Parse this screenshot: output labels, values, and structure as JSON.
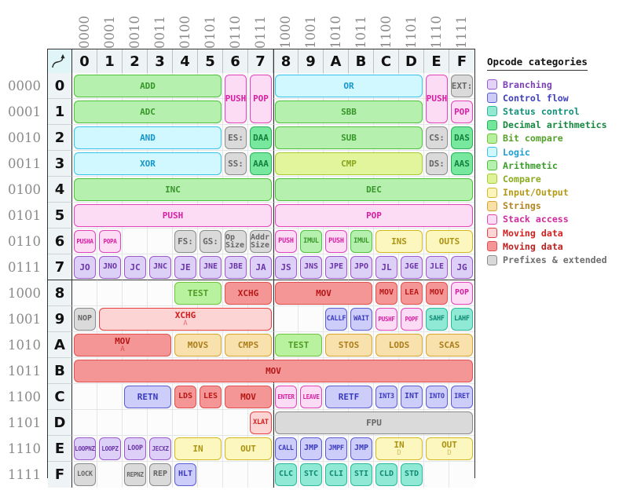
{
  "table": {
    "corner_icon": "arrow-up-right-icon",
    "col_headers": [
      "0",
      "1",
      "2",
      "3",
      "4",
      "5",
      "6",
      "7",
      "8",
      "9",
      "A",
      "B",
      "C",
      "D",
      "E",
      "F"
    ],
    "col_binary": [
      "0000",
      "0001",
      "0010",
      "0011",
      "0100",
      "0101",
      "0110",
      "0111",
      "1000",
      "1001",
      "1010",
      "1011",
      "1100",
      "1101",
      "1110",
      "1111"
    ],
    "row_headers": [
      "0",
      "1",
      "2",
      "3",
      "4",
      "5",
      "6",
      "7",
      "8",
      "9",
      "A",
      "B",
      "C",
      "D",
      "E",
      "F"
    ],
    "row_binary": [
      "0000",
      "0001",
      "0010",
      "0011",
      "0100",
      "0101",
      "0110",
      "0111",
      "1000",
      "1001",
      "1010",
      "1011",
      "1100",
      "1101",
      "1110",
      "1111"
    ]
  },
  "legend": {
    "title": "Opcode categories",
    "items": [
      {
        "label": "Branching",
        "fill": "#e3d3f7",
        "stroke": "#9b59d0",
        "text": "#7b3fb8"
      },
      {
        "label": "Control flow",
        "fill": "#ccccf7",
        "stroke": "#5b5bd6",
        "text": "#4040c0"
      },
      {
        "label": "Status control",
        "fill": "#92e8d0",
        "stroke": "#2cb89a",
        "text": "#11907a"
      },
      {
        "label": "Decimal arithmetics",
        "fill": "#72e69a",
        "stroke": "#27b258",
        "text": "#17883f"
      },
      {
        "label": "Bit compare",
        "fill": "#b6f09c",
        "stroke": "#6fc23a",
        "text": "#55a02a"
      },
      {
        "label": "Logic",
        "fill": "#d0f7ff",
        "stroke": "#35c2ee",
        "text": "#1e9fd0"
      },
      {
        "label": "Arithmetic",
        "fill": "#b6f0ae",
        "stroke": "#4ec23a",
        "text": "#3a9e2a"
      },
      {
        "label": "Compare",
        "fill": "#dff29a",
        "stroke": "#a7cc2f",
        "text": "#8aab20"
      },
      {
        "label": "Input/Output",
        "fill": "#fbf5bd",
        "stroke": "#d4b820",
        "text": "#b39a16"
      },
      {
        "label": "Strings",
        "fill": "#f7dfa8",
        "stroke": "#d9a42e",
        "text": "#b38420"
      },
      {
        "label": "Stack access",
        "fill": "#fcddf4",
        "stroke": "#e243b8",
        "text": "#d12aa0"
      },
      {
        "label": "Moving data",
        "fill": "#fcd6d6",
        "stroke": "#e84040",
        "text": "#d52020"
      },
      {
        "label": "Moving data",
        "fill": "#f59696",
        "stroke": "#e05050",
        "text": "#c02020"
      },
      {
        "label": "Prefixes & extended",
        "fill": "#d8d8d8",
        "stroke": "#8a8a8a",
        "text": "#6e6e6e"
      }
    ]
  },
  "palette": {
    "branching": {
      "fill": "#ddd0f7",
      "stroke": "#9b59d0",
      "text": "#6a34a8"
    },
    "control": {
      "fill": "#cdcdf9",
      "stroke": "#5b5bd6",
      "text": "#3a3ac0"
    },
    "status": {
      "fill": "#8fe9d4",
      "stroke": "#2cb89a",
      "text": "#0e8a74"
    },
    "decimal": {
      "fill": "#78e89e",
      "stroke": "#27b258",
      "text": "#15803c"
    },
    "bitcompare": {
      "fill": "#b8f29e",
      "stroke": "#6fc23a",
      "text": "#4f9c25"
    },
    "logic": {
      "fill": "#d2f8ff",
      "stroke": "#35c2ee",
      "text": "#1595cb"
    },
    "arithmetic": {
      "fill": "#b6f0ae",
      "stroke": "#4ec23a",
      "text": "#37962a"
    },
    "compare": {
      "fill": "#e2f49c",
      "stroke": "#a7cc2f",
      "text": "#86a61c"
    },
    "io": {
      "fill": "#fcf7bf",
      "stroke": "#d4b820",
      "text": "#ad9312"
    },
    "strings": {
      "fill": "#f8e1ac",
      "stroke": "#d9a42e",
      "text": "#ad7e1c"
    },
    "stack": {
      "fill": "#fcdcf4",
      "stroke": "#e243b8",
      "text": "#d81fa2"
    },
    "moving": {
      "fill": "#fcd4d4",
      "stroke": "#e84040",
      "text": "#d41c1c"
    },
    "moving2": {
      "fill": "#f59696",
      "stroke": "#e05050",
      "text": "#b81818"
    },
    "prefix": {
      "fill": "#dadada",
      "stroke": "#8a8a8a",
      "text": "#666666"
    }
  },
  "cells": [
    {
      "row": 0,
      "col": 0,
      "span": 6,
      "rows": 1,
      "label": "ADD",
      "cat": "arithmetic"
    },
    {
      "row": 0,
      "col": 6,
      "span": 1,
      "rows": 2,
      "label": "PUSH",
      "cat": "stack"
    },
    {
      "row": 0,
      "col": 7,
      "span": 1,
      "rows": 2,
      "label": "POP",
      "cat": "stack"
    },
    {
      "row": 0,
      "col": 8,
      "span": 6,
      "rows": 1,
      "label": "OR",
      "cat": "logic"
    },
    {
      "row": 0,
      "col": 14,
      "span": 1,
      "rows": 2,
      "label": "PUSH",
      "cat": "stack"
    },
    {
      "row": 0,
      "col": 15,
      "span": 1,
      "rows": 1,
      "label": "EXT:",
      "cat": "prefix"
    },
    {
      "row": 1,
      "col": 0,
      "span": 6,
      "rows": 1,
      "label": "ADC",
      "cat": "arithmetic"
    },
    {
      "row": 1,
      "col": 8,
      "span": 6,
      "rows": 1,
      "label": "SBB",
      "cat": "arithmetic"
    },
    {
      "row": 1,
      "col": 15,
      "span": 1,
      "rows": 1,
      "label": "POP",
      "cat": "stack"
    },
    {
      "row": 2,
      "col": 0,
      "span": 6,
      "rows": 1,
      "label": "AND",
      "cat": "logic"
    },
    {
      "row": 2,
      "col": 6,
      "span": 1,
      "rows": 1,
      "label": "ES:",
      "cat": "prefix"
    },
    {
      "row": 2,
      "col": 7,
      "span": 1,
      "rows": 1,
      "label": "DAA",
      "cat": "decimal"
    },
    {
      "row": 2,
      "col": 8,
      "span": 6,
      "rows": 1,
      "label": "SUB",
      "cat": "arithmetic"
    },
    {
      "row": 2,
      "col": 14,
      "span": 1,
      "rows": 1,
      "label": "CS:",
      "cat": "prefix"
    },
    {
      "row": 2,
      "col": 15,
      "span": 1,
      "rows": 1,
      "label": "DAS",
      "cat": "decimal"
    },
    {
      "row": 3,
      "col": 0,
      "span": 6,
      "rows": 1,
      "label": "XOR",
      "cat": "logic"
    },
    {
      "row": 3,
      "col": 6,
      "span": 1,
      "rows": 1,
      "label": "SS:",
      "cat": "prefix"
    },
    {
      "row": 3,
      "col": 7,
      "span": 1,
      "rows": 1,
      "label": "AAA",
      "cat": "decimal"
    },
    {
      "row": 3,
      "col": 8,
      "span": 6,
      "rows": 1,
      "label": "CMP",
      "cat": "compare"
    },
    {
      "row": 3,
      "col": 14,
      "span": 1,
      "rows": 1,
      "label": "DS:",
      "cat": "prefix"
    },
    {
      "row": 3,
      "col": 15,
      "span": 1,
      "rows": 1,
      "label": "AAS",
      "cat": "decimal"
    },
    {
      "row": 4,
      "col": 0,
      "span": 8,
      "rows": 1,
      "label": "INC",
      "cat": "arithmetic"
    },
    {
      "row": 4,
      "col": 8,
      "span": 8,
      "rows": 1,
      "label": "DEC",
      "cat": "arithmetic"
    },
    {
      "row": 5,
      "col": 0,
      "span": 8,
      "rows": 1,
      "label": "PUSH",
      "cat": "stack"
    },
    {
      "row": 5,
      "col": 8,
      "span": 8,
      "rows": 1,
      "label": "POP",
      "cat": "stack"
    },
    {
      "row": 6,
      "col": 0,
      "span": 1,
      "rows": 1,
      "label": "PUSHA",
      "cat": "stack",
      "size": "f8"
    },
    {
      "row": 6,
      "col": 1,
      "span": 1,
      "rows": 1,
      "label": "POPA",
      "cat": "stack",
      "size": "f8"
    },
    {
      "row": 6,
      "col": 4,
      "span": 1,
      "rows": 1,
      "label": "FS:",
      "cat": "prefix"
    },
    {
      "row": 6,
      "col": 5,
      "span": 1,
      "rows": 1,
      "label": "GS:",
      "cat": "prefix"
    },
    {
      "row": 6,
      "col": 6,
      "span": 1,
      "rows": 1,
      "label": "Op Size",
      "cat": "prefix",
      "wrap": true
    },
    {
      "row": 6,
      "col": 7,
      "span": 1,
      "rows": 1,
      "label": "Addr Size",
      "cat": "prefix",
      "wrap": true
    },
    {
      "row": 6,
      "col": 8,
      "span": 1,
      "rows": 1,
      "label": "PUSH",
      "cat": "stack",
      "size": "f9"
    },
    {
      "row": 6,
      "col": 9,
      "span": 1,
      "rows": 1,
      "label": "IMUL",
      "cat": "arithmetic",
      "size": "f9"
    },
    {
      "row": 6,
      "col": 10,
      "span": 1,
      "rows": 1,
      "label": "PUSH",
      "cat": "stack",
      "size": "f9"
    },
    {
      "row": 6,
      "col": 11,
      "span": 1,
      "rows": 1,
      "label": "IMUL",
      "cat": "arithmetic",
      "size": "f9"
    },
    {
      "row": 6,
      "col": 12,
      "span": 2,
      "rows": 1,
      "label": "INS",
      "cat": "io"
    },
    {
      "row": 6,
      "col": 14,
      "span": 2,
      "rows": 1,
      "label": "OUTS",
      "cat": "io"
    },
    {
      "row": 7,
      "col": 0,
      "span": 1,
      "rows": 1,
      "label": "JO",
      "cat": "branching"
    },
    {
      "row": 7,
      "col": 1,
      "span": 1,
      "rows": 1,
      "label": "JNO",
      "cat": "branching",
      "size": "f10"
    },
    {
      "row": 7,
      "col": 2,
      "span": 1,
      "rows": 1,
      "label": "JC",
      "cat": "branching"
    },
    {
      "row": 7,
      "col": 3,
      "span": 1,
      "rows": 1,
      "label": "JNC",
      "cat": "branching",
      "size": "f10"
    },
    {
      "row": 7,
      "col": 4,
      "span": 1,
      "rows": 1,
      "label": "JE",
      "cat": "branching"
    },
    {
      "row": 7,
      "col": 5,
      "span": 1,
      "rows": 1,
      "label": "JNE",
      "cat": "branching",
      "size": "f10"
    },
    {
      "row": 7,
      "col": 6,
      "span": 1,
      "rows": 1,
      "label": "JBE",
      "cat": "branching",
      "size": "f10"
    },
    {
      "row": 7,
      "col": 7,
      "span": 1,
      "rows": 1,
      "label": "JA",
      "cat": "branching"
    },
    {
      "row": 7,
      "col": 8,
      "span": 1,
      "rows": 1,
      "label": "JS",
      "cat": "branching"
    },
    {
      "row": 7,
      "col": 9,
      "span": 1,
      "rows": 1,
      "label": "JNS",
      "cat": "branching",
      "size": "f10"
    },
    {
      "row": 7,
      "col": 10,
      "span": 1,
      "rows": 1,
      "label": "JPE",
      "cat": "branching",
      "size": "f10"
    },
    {
      "row": 7,
      "col": 11,
      "span": 1,
      "rows": 1,
      "label": "JPO",
      "cat": "branching",
      "size": "f10"
    },
    {
      "row": 7,
      "col": 12,
      "span": 1,
      "rows": 1,
      "label": "JL",
      "cat": "branching"
    },
    {
      "row": 7,
      "col": 13,
      "span": 1,
      "rows": 1,
      "label": "JGE",
      "cat": "branching",
      "size": "f10"
    },
    {
      "row": 7,
      "col": 14,
      "span": 1,
      "rows": 1,
      "label": "JLE",
      "cat": "branching",
      "size": "f10"
    },
    {
      "row": 7,
      "col": 15,
      "span": 1,
      "rows": 1,
      "label": "JG",
      "cat": "branching"
    },
    {
      "row": 8,
      "col": 4,
      "span": 2,
      "rows": 1,
      "label": "TEST",
      "cat": "bitcompare"
    },
    {
      "row": 8,
      "col": 6,
      "span": 2,
      "rows": 1,
      "label": "XCHG",
      "cat": "moving2"
    },
    {
      "row": 8,
      "col": 8,
      "span": 4,
      "rows": 1,
      "label": "MOV",
      "cat": "moving2"
    },
    {
      "row": 8,
      "col": 12,
      "span": 1,
      "rows": 1,
      "label": "MOV",
      "cat": "moving2",
      "size": "f10"
    },
    {
      "row": 8,
      "col": 13,
      "span": 1,
      "rows": 1,
      "label": "LEA",
      "cat": "moving2",
      "size": "f10"
    },
    {
      "row": 8,
      "col": 14,
      "span": 1,
      "rows": 1,
      "label": "MOV",
      "cat": "moving2",
      "size": "f10"
    },
    {
      "row": 8,
      "col": 15,
      "span": 1,
      "rows": 1,
      "label": "POP",
      "cat": "stack",
      "size": "f10"
    },
    {
      "row": 9,
      "col": 0,
      "span": 1,
      "rows": 1,
      "label": "NOP",
      "cat": "prefix",
      "size": "f10"
    },
    {
      "row": 9,
      "col": 1,
      "span": 7,
      "rows": 1,
      "label": "XCHG",
      "sub": "A",
      "cat": "moving"
    },
    {
      "row": 9,
      "col": 10,
      "span": 1,
      "rows": 1,
      "label": "CALLF",
      "cat": "control",
      "size": "f9"
    },
    {
      "row": 9,
      "col": 11,
      "span": 1,
      "rows": 1,
      "label": "WAIT",
      "cat": "control",
      "size": "f9"
    },
    {
      "row": 9,
      "col": 12,
      "span": 1,
      "rows": 1,
      "label": "PUSHF",
      "cat": "stack",
      "size": "f8"
    },
    {
      "row": 9,
      "col": 13,
      "span": 1,
      "rows": 1,
      "label": "POPF",
      "cat": "stack",
      "size": "f8"
    },
    {
      "row": 9,
      "col": 14,
      "span": 1,
      "rows": 1,
      "label": "SAHF",
      "cat": "status",
      "size": "f9"
    },
    {
      "row": 9,
      "col": 15,
      "span": 1,
      "rows": 1,
      "label": "LAHF",
      "cat": "status",
      "size": "f9"
    },
    {
      "row": 10,
      "col": 0,
      "span": 4,
      "rows": 1,
      "label": "MOV",
      "sub": "A",
      "cat": "moving2"
    },
    {
      "row": 10,
      "col": 4,
      "span": 2,
      "rows": 1,
      "label": "MOVS",
      "cat": "strings"
    },
    {
      "row": 10,
      "col": 6,
      "span": 2,
      "rows": 1,
      "label": "CMPS",
      "cat": "strings"
    },
    {
      "row": 10,
      "col": 8,
      "span": 2,
      "rows": 1,
      "label": "TEST",
      "cat": "bitcompare"
    },
    {
      "row": 10,
      "col": 10,
      "span": 2,
      "rows": 1,
      "label": "STOS",
      "cat": "strings"
    },
    {
      "row": 10,
      "col": 12,
      "span": 2,
      "rows": 1,
      "label": "LODS",
      "cat": "strings"
    },
    {
      "row": 10,
      "col": 14,
      "span": 2,
      "rows": 1,
      "label": "SCAS",
      "cat": "strings"
    },
    {
      "row": 11,
      "col": 0,
      "span": 16,
      "rows": 1,
      "label": "MOV",
      "cat": "moving2"
    },
    {
      "row": 12,
      "col": 2,
      "span": 2,
      "rows": 1,
      "label": "RETN",
      "cat": "control"
    },
    {
      "row": 12,
      "col": 4,
      "span": 1,
      "rows": 1,
      "label": "LDS",
      "cat": "moving2",
      "size": "f10"
    },
    {
      "row": 12,
      "col": 5,
      "span": 1,
      "rows": 1,
      "label": "LES",
      "cat": "moving2",
      "size": "f10"
    },
    {
      "row": 12,
      "col": 6,
      "span": 2,
      "rows": 1,
      "label": "MOV",
      "cat": "moving2"
    },
    {
      "row": 12,
      "col": 8,
      "span": 1,
      "rows": 1,
      "label": "ENTER",
      "cat": "stack",
      "size": "f8"
    },
    {
      "row": 12,
      "col": 9,
      "span": 1,
      "rows": 1,
      "label": "LEAVE",
      "cat": "stack",
      "size": "f8"
    },
    {
      "row": 12,
      "col": 10,
      "span": 2,
      "rows": 1,
      "label": "RETF",
      "cat": "control"
    },
    {
      "row": 12,
      "col": 12,
      "span": 1,
      "rows": 1,
      "label": "INT3",
      "cat": "control",
      "size": "f9"
    },
    {
      "row": 12,
      "col": 13,
      "span": 1,
      "rows": 1,
      "label": "INT",
      "cat": "control",
      "size": "f10"
    },
    {
      "row": 12,
      "col": 14,
      "span": 1,
      "rows": 1,
      "label": "INTO",
      "cat": "control",
      "size": "f9"
    },
    {
      "row": 12,
      "col": 15,
      "span": 1,
      "rows": 1,
      "label": "IRET",
      "cat": "control",
      "size": "f9"
    },
    {
      "row": 13,
      "col": 7,
      "span": 1,
      "rows": 1,
      "label": "XLAT",
      "cat": "moving",
      "size": "f9"
    },
    {
      "row": 13,
      "col": 8,
      "span": 8,
      "rows": 1,
      "label": "FPU",
      "cat": "prefix"
    },
    {
      "row": 14,
      "col": 0,
      "span": 1,
      "rows": 1,
      "label": "LOOPNZ",
      "cat": "branching",
      "size": "f8"
    },
    {
      "row": 14,
      "col": 1,
      "span": 1,
      "rows": 1,
      "label": "LOOPZ",
      "cat": "branching",
      "size": "f8"
    },
    {
      "row": 14,
      "col": 2,
      "span": 1,
      "rows": 1,
      "label": "LOOP",
      "cat": "branching",
      "size": "f9"
    },
    {
      "row": 14,
      "col": 3,
      "span": 1,
      "rows": 1,
      "label": "JECXZ",
      "cat": "branching",
      "size": "f8"
    },
    {
      "row": 14,
      "col": 4,
      "span": 2,
      "rows": 1,
      "label": "IN",
      "cat": "io"
    },
    {
      "row": 14,
      "col": 6,
      "span": 2,
      "rows": 1,
      "label": "OUT",
      "cat": "io"
    },
    {
      "row": 14,
      "col": 8,
      "span": 1,
      "rows": 1,
      "label": "CALL",
      "cat": "control",
      "size": "f9"
    },
    {
      "row": 14,
      "col": 9,
      "span": 1,
      "rows": 1,
      "label": "JMP",
      "cat": "control",
      "size": "f10"
    },
    {
      "row": 14,
      "col": 10,
      "span": 1,
      "rows": 1,
      "label": "JMPF",
      "cat": "control",
      "size": "f9"
    },
    {
      "row": 14,
      "col": 11,
      "span": 1,
      "rows": 1,
      "label": "JMP",
      "cat": "control",
      "size": "f10"
    },
    {
      "row": 14,
      "col": 12,
      "span": 2,
      "rows": 1,
      "label": "IN",
      "sub": "D",
      "cat": "io"
    },
    {
      "row": 14,
      "col": 14,
      "span": 2,
      "rows": 1,
      "label": "OUT",
      "sub": "D",
      "cat": "io"
    },
    {
      "row": 15,
      "col": 0,
      "span": 1,
      "rows": 1,
      "label": "LOCK",
      "cat": "prefix",
      "size": "f9"
    },
    {
      "row": 15,
      "col": 2,
      "span": 1,
      "rows": 1,
      "label": "REPNZ",
      "cat": "prefix",
      "size": "f8"
    },
    {
      "row": 15,
      "col": 3,
      "span": 1,
      "rows": 1,
      "label": "REP",
      "cat": "prefix",
      "size": "f10"
    },
    {
      "row": 15,
      "col": 4,
      "span": 1,
      "rows": 1,
      "label": "HLT",
      "cat": "control",
      "size": "f10"
    },
    {
      "row": 15,
      "col": 8,
      "span": 1,
      "rows": 1,
      "label": "CLC",
      "cat": "status",
      "size": "f10"
    },
    {
      "row": 15,
      "col": 9,
      "span": 1,
      "rows": 1,
      "label": "STC",
      "cat": "status",
      "size": "f10"
    },
    {
      "row": 15,
      "col": 10,
      "span": 1,
      "rows": 1,
      "label": "CLI",
      "cat": "status",
      "size": "f10"
    },
    {
      "row": 15,
      "col": 11,
      "span": 1,
      "rows": 1,
      "label": "STI",
      "cat": "status",
      "size": "f10"
    },
    {
      "row": 15,
      "col": 12,
      "span": 1,
      "rows": 1,
      "label": "CLD",
      "cat": "status",
      "size": "f10"
    },
    {
      "row": 15,
      "col": 13,
      "span": 1,
      "rows": 1,
      "label": "STD",
      "cat": "status",
      "size": "f10"
    }
  ]
}
